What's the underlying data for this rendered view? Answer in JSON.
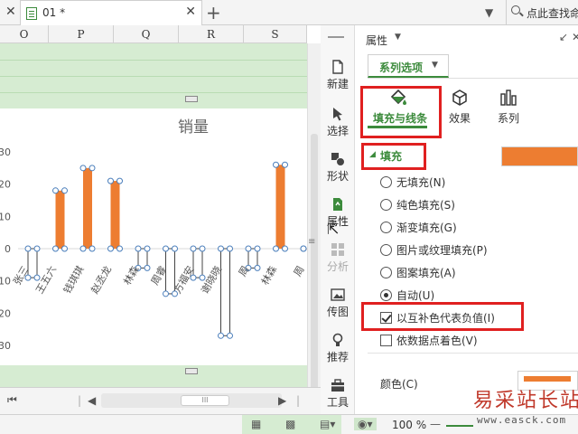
{
  "titlebar": {
    "document_title": "01 *",
    "search_placeholder": "点此查找命"
  },
  "sheet": {
    "columns": [
      "O",
      "P",
      "Q",
      "R",
      "S"
    ]
  },
  "chart_data": {
    "type": "bar",
    "title": "销量",
    "categories": [
      "张三",
      "王五六",
      "钱琪琪",
      "赵丞龙",
      "林森",
      "周睿",
      "方福安",
      "谢晓晓",
      "周",
      "林森",
      "周"
    ],
    "values": [
      -9,
      18,
      25,
      21,
      -6,
      -14,
      -9,
      -27,
      -6,
      26,
      0
    ],
    "yticks": [
      "30",
      "20",
      "10",
      "0",
      "-10",
      "-20",
      "-30"
    ],
    "ylim": [
      -30,
      30
    ],
    "positive_color": "#ed7d31",
    "negative_color": "#ffffff"
  },
  "side_toolbar": {
    "items": [
      {
        "label": "新建",
        "icon": "new-document-icon"
      },
      {
        "label": "选择",
        "icon": "select-arrow-icon"
      },
      {
        "label": "形状",
        "icon": "shapes-icon"
      },
      {
        "label": "属性",
        "icon": "properties-icon"
      },
      {
        "label": "分析",
        "icon": "analysis-icon"
      },
      {
        "label": "传图",
        "icon": "image-upload-icon"
      },
      {
        "label": "推荐",
        "icon": "recommend-icon"
      },
      {
        "label": "工具",
        "icon": "toolbox-icon"
      }
    ]
  },
  "panel": {
    "title": "属性",
    "series_tab_label": "系列选项",
    "subtabs": {
      "fill_line": "填充与线条",
      "effect": "效果",
      "series": "系列"
    },
    "fill_section_title": "填充",
    "fill_options": [
      {
        "label": "无填充(N)",
        "checked": false
      },
      {
        "label": "纯色填充(S)",
        "checked": false
      },
      {
        "label": "渐变填充(G)",
        "checked": false
      },
      {
        "label": "图片或纹理填充(P)",
        "checked": false
      },
      {
        "label": "图案填充(A)",
        "checked": false
      },
      {
        "label": "自动(U)",
        "checked": true
      }
    ],
    "checkboxes": [
      {
        "label": "以互补色代表负值(I)",
        "checked": true
      },
      {
        "label": "依数据点着色(V)",
        "checked": false
      }
    ],
    "color_label": "颜色(C)",
    "fill_color": "#ed7d31"
  },
  "statusbar": {
    "zoom": "100 %"
  },
  "watermark": {
    "text_cn": "易采站长站",
    "url": "www.easck.com"
  }
}
